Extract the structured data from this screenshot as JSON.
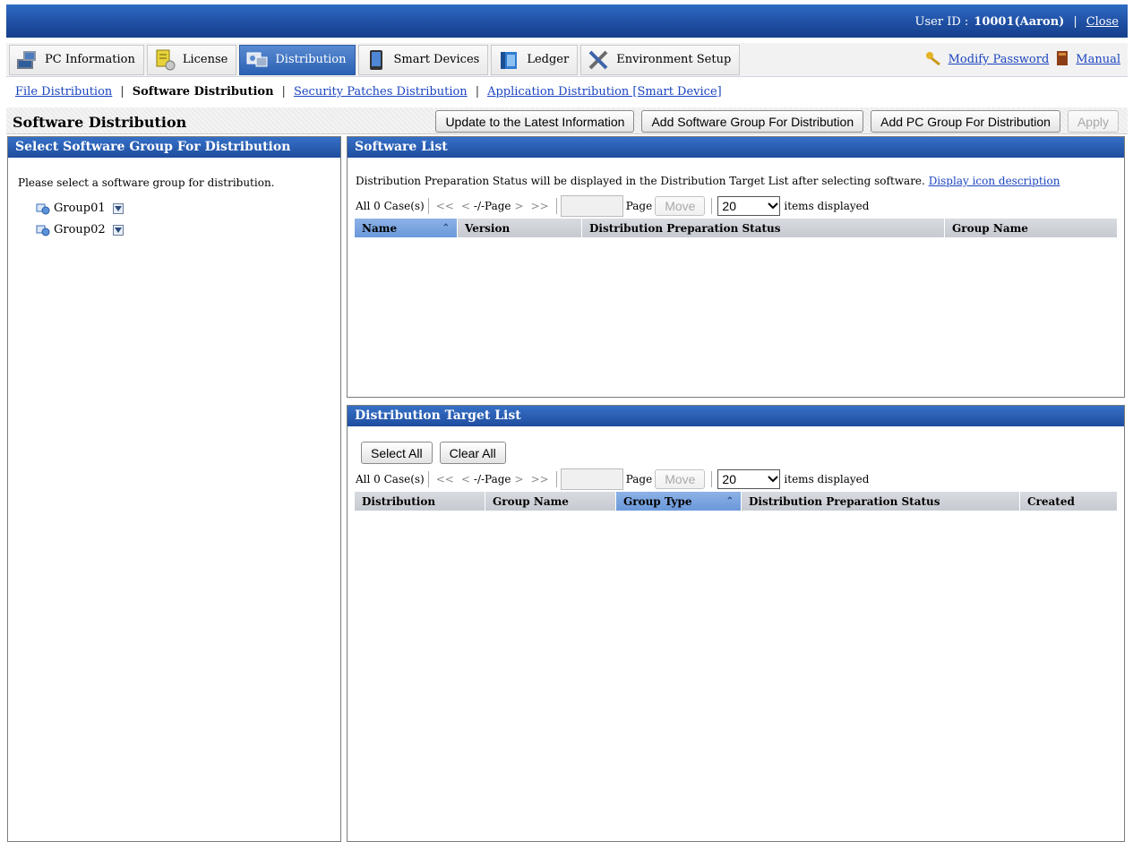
{
  "header": {
    "user_label": "User ID : ",
    "user_value": "10001(Aaron)",
    "close": "Close"
  },
  "tabs": [
    {
      "label": "PC Information",
      "icon": "pc-icon",
      "active": false
    },
    {
      "label": "License",
      "icon": "license-icon",
      "active": false
    },
    {
      "label": "Distribution",
      "icon": "distribution-icon",
      "active": true
    },
    {
      "label": "Smart Devices",
      "icon": "smart-device-icon",
      "active": false
    },
    {
      "label": "Ledger",
      "icon": "ledger-icon",
      "active": false
    },
    {
      "label": "Environment Setup",
      "icon": "tools-icon",
      "active": false
    }
  ],
  "toplinks": {
    "modify_password": "Modify Password",
    "manual": "Manual"
  },
  "subnav": {
    "file_distribution": "File Distribution",
    "software_distribution": "Software Distribution",
    "security_patches": "Security Patches Distribution",
    "app_distribution": "Application Distribution [Smart Device]"
  },
  "page": {
    "title": "Software Distribution",
    "btn_update": "Update to the Latest Information",
    "btn_add_sw_group": "Add Software Group For Distribution",
    "btn_add_pc_group": "Add PC Group For Distribution",
    "btn_apply": "Apply"
  },
  "left": {
    "title": "Select Software Group For Distribution",
    "hint": "Please select a software group for distribution.",
    "groups": [
      "Group01",
      "Group02"
    ]
  },
  "software_list": {
    "title": "Software List",
    "note": "Distribution Preparation Status will be displayed in the Distribution Target List after selecting software.",
    "icon_link": "Display icon description",
    "pager": {
      "count": "All 0 Case(s)",
      "nav_first": "<<",
      "nav_prev": "<",
      "page_ind": "-/-Page",
      "nav_next": ">",
      "nav_last": ">>",
      "page_label": "Page",
      "move": "Move",
      "per_page": "20",
      "items_displayed": "items displayed"
    },
    "columns": [
      "Name",
      "Version",
      "Distribution Preparation Status",
      "Group Name"
    ]
  },
  "target_list": {
    "title": "Distribution Target List",
    "select_all": "Select All",
    "clear_all": "Clear All",
    "pager": {
      "count": "All 0 Case(s)",
      "nav_first": "<<",
      "nav_prev": "<",
      "page_ind": "-/-Page",
      "nav_next": ">",
      "nav_last": ">>",
      "page_label": "Page",
      "move": "Move",
      "per_page": "20",
      "items_displayed": "items displayed"
    },
    "columns": [
      "Distribution",
      "Group Name",
      "Group Type",
      "Distribution Preparation Status",
      "Created"
    ]
  }
}
